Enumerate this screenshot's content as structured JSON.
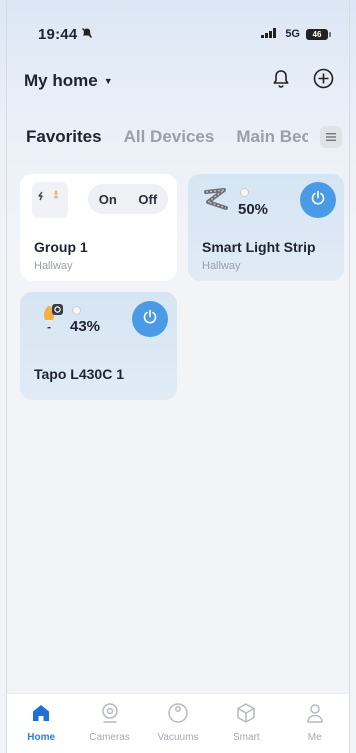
{
  "status": {
    "time": "19:44",
    "network": "5G",
    "battery": "46"
  },
  "header": {
    "home_title": "My home"
  },
  "tabs": [
    {
      "label": "Favorites"
    },
    {
      "label": "All Devices"
    },
    {
      "label": "Main Bec"
    }
  ],
  "cards": {
    "group1": {
      "name": "Group 1",
      "room": "Hallway",
      "on_label": "On",
      "off_label": "Off"
    },
    "strip": {
      "name": "Smart Light Strip",
      "room": "Hallway",
      "brightness": "50%"
    },
    "bulb": {
      "name": "Tapo L430C 1",
      "brightness": "43%"
    }
  },
  "tabbar": [
    {
      "label": "Home",
      "icon": "home-icon"
    },
    {
      "label": "Cameras",
      "icon": "camera-icon"
    },
    {
      "label": "Vacuums",
      "icon": "vacuum-icon"
    },
    {
      "label": "Smart",
      "icon": "cube-icon"
    },
    {
      "label": "Me",
      "icon": "person-icon"
    }
  ],
  "colors": {
    "accent": "#4a9ae6",
    "active_tab": "#2a7de1",
    "card_blue": "#d6e5f3"
  }
}
